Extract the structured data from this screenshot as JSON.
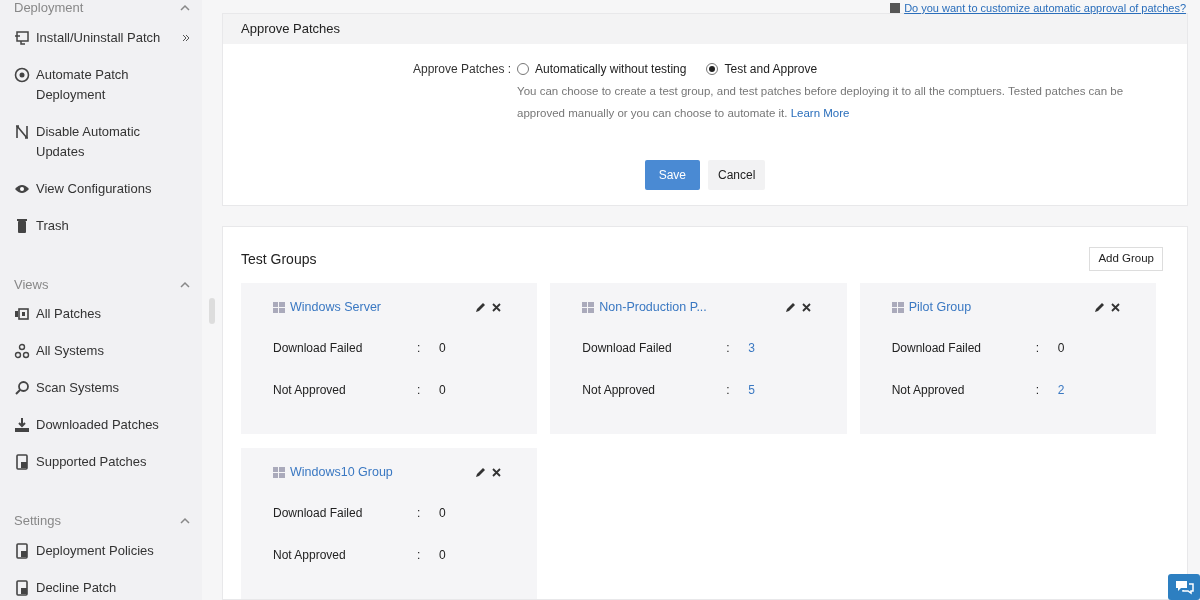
{
  "sidebar": {
    "sections": [
      {
        "title": "Deployment",
        "expanded": true,
        "items": [
          {
            "label": "Install/Uninstall Patch",
            "submenu": true
          },
          {
            "label": "Automate Patch Deployment",
            "submenu": false
          },
          {
            "label": "Disable Automatic Updates",
            "submenu": false
          },
          {
            "label": "View Configurations",
            "submenu": false
          },
          {
            "label": "Trash",
            "submenu": false
          }
        ]
      },
      {
        "title": "Views",
        "expanded": true,
        "items": [
          {
            "label": "All Patches",
            "submenu": false
          },
          {
            "label": "All Systems",
            "submenu": false
          },
          {
            "label": "Scan Systems",
            "submenu": false
          },
          {
            "label": "Downloaded Patches",
            "submenu": false
          },
          {
            "label": "Supported Patches",
            "submenu": false
          }
        ]
      },
      {
        "title": "Settings",
        "expanded": true,
        "items": [
          {
            "label": "Deployment Policies",
            "submenu": false
          },
          {
            "label": "Decline Patch",
            "submenu": false
          }
        ]
      }
    ]
  },
  "top_link": "Do you want to customize automatic approval of patches?",
  "approve_panel": {
    "title": "Approve Patches",
    "field_label": "Approve Patches :",
    "options": [
      {
        "label": "Automatically without testing",
        "selected": false
      },
      {
        "label": "Test and Approve",
        "selected": true
      }
    ],
    "description": "You can choose to create a test group, and test patches before deploying it to all the comptuers. Tested patches can be approved manually or you can choose to automate it.",
    "learn_more": "Learn More",
    "buttons": [
      {
        "label": "Save",
        "kind": "primary"
      },
      {
        "label": "Cancel",
        "kind": "secondary"
      }
    ]
  },
  "test_groups": {
    "title": "Test Groups",
    "add_button": "Add Group",
    "groups": [
      {
        "name": "Windows Server",
        "rows": [
          {
            "label": "Download Failed",
            "separator": ":",
            "value": "0",
            "link": false
          },
          {
            "label": "Not Approved",
            "separator": ":",
            "value": "0",
            "link": false
          }
        ]
      },
      {
        "name": "Non-Production P...",
        "rows": [
          {
            "label": "Download Failed",
            "separator": ":",
            "value": "3",
            "link": true
          },
          {
            "label": "Not Approved",
            "separator": ":",
            "value": "5",
            "link": true
          }
        ]
      },
      {
        "name": "Pilot Group",
        "rows": [
          {
            "label": "Download Failed",
            "separator": ":",
            "value": "0",
            "link": false
          },
          {
            "label": "Not Approved",
            "separator": ":",
            "value": "2",
            "link": true
          }
        ]
      },
      {
        "name": "Windows10 Group",
        "rows": [
          {
            "label": "Download Failed",
            "separator": ":",
            "value": "0",
            "link": false
          },
          {
            "label": "Not Approved",
            "separator": ":",
            "value": "0",
            "link": false
          }
        ]
      }
    ]
  }
}
